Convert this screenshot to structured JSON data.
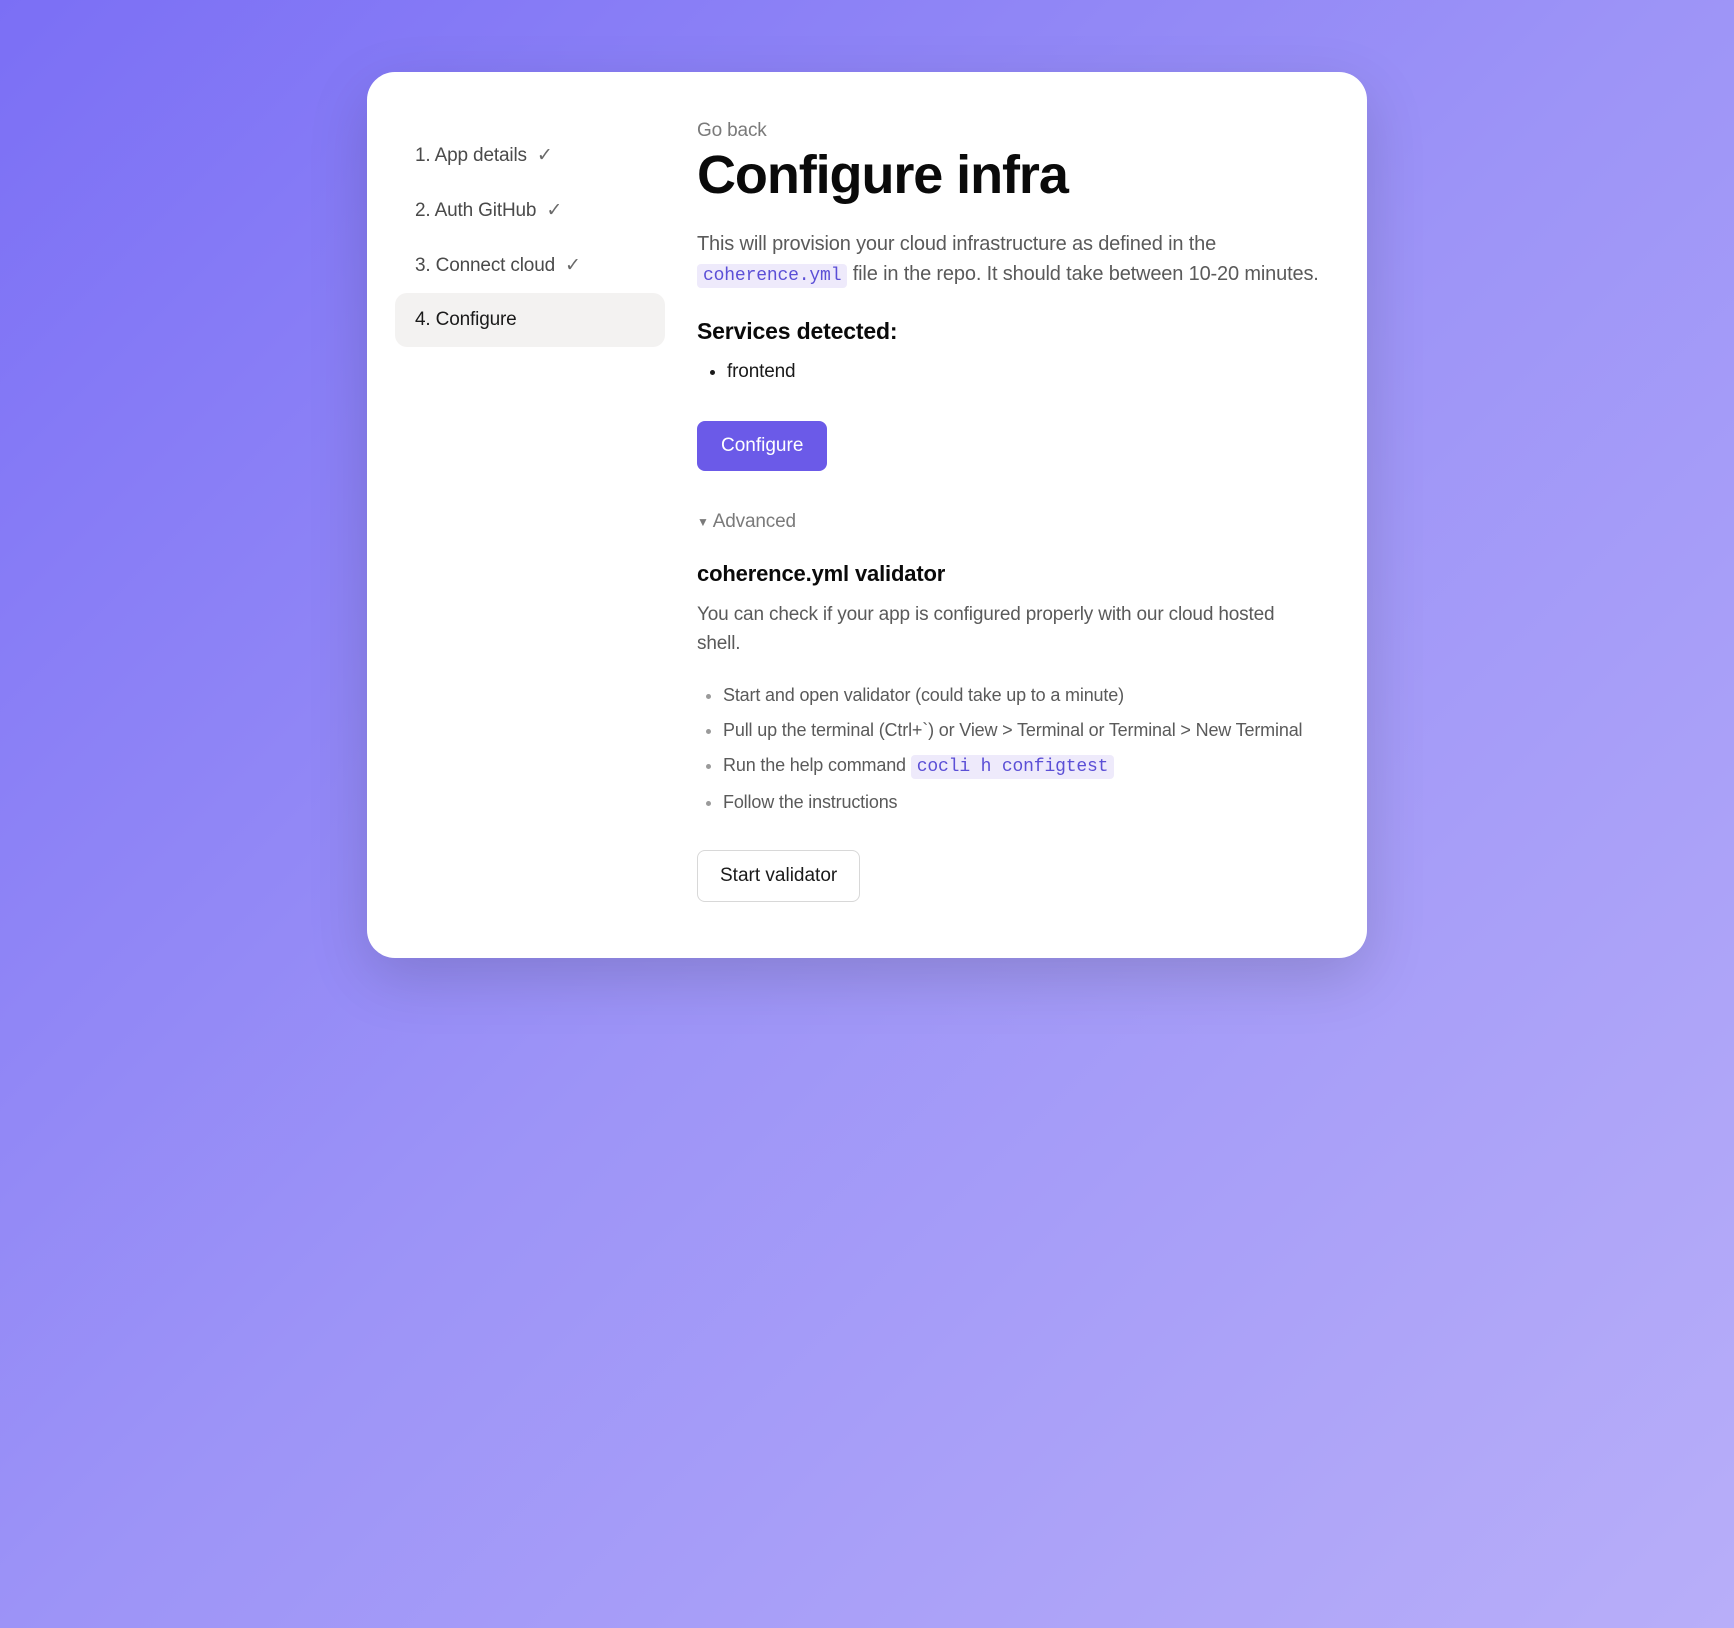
{
  "sidebar": {
    "steps": [
      {
        "label": "1. App details",
        "completed": true,
        "active": false
      },
      {
        "label": "2. Auth GitHub",
        "completed": true,
        "active": false
      },
      {
        "label": "3. Connect cloud",
        "completed": true,
        "active": false
      },
      {
        "label": "4. Configure",
        "completed": false,
        "active": true
      }
    ]
  },
  "main": {
    "go_back_label": "Go back",
    "title": "Configure infra",
    "description_pre": "This will provision your cloud infrastructure as defined in the ",
    "description_code": "coherence.yml",
    "description_post": " file in the repo. It should take between 10-20 minutes.",
    "services_heading": "Services detected:",
    "services": [
      "frontend"
    ],
    "configure_button": "Configure",
    "advanced_label": "Advanced",
    "validator": {
      "heading": "coherence.yml validator",
      "description": "You can check if your app is configured properly with our cloud hosted shell.",
      "steps": [
        {
          "text": "Start and open validator (could take up to a minute)"
        },
        {
          "text": "Pull up the terminal (Ctrl+`) or View > Terminal or Terminal > New Terminal"
        },
        {
          "text_pre": "Run the help command ",
          "code": "cocli h configtest"
        },
        {
          "text": "Follow the instructions"
        }
      ],
      "start_button": "Start validator"
    }
  }
}
